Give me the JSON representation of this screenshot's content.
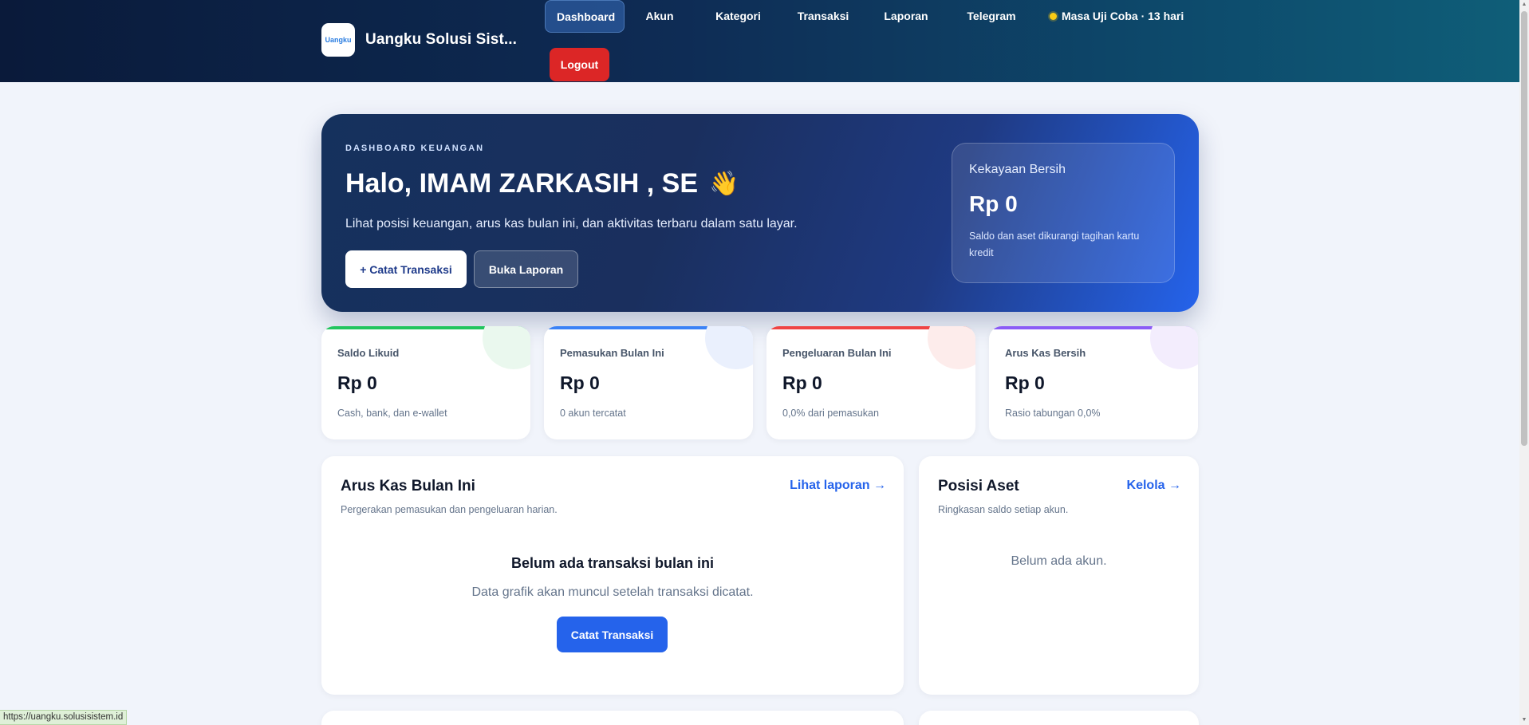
{
  "app": {
    "logo_text": "Uangku",
    "brand_name": "Uangku Solusi Sist..."
  },
  "nav": {
    "items": [
      {
        "label": "Dashboard",
        "active": true
      },
      {
        "label": "Akun"
      },
      {
        "label": "Kategori"
      },
      {
        "label": "Transaksi"
      },
      {
        "label": "Laporan"
      },
      {
        "label": "Telegram"
      }
    ],
    "trial_label": "Masa Uji Coba · 13 hari",
    "logout_label": "Logout"
  },
  "hero": {
    "kicker": "DASHBOARD KEUANGAN",
    "greeting": "Halo, IMAM ZARKASIH , SE",
    "wave": "👋",
    "subtitle": "Lihat posisi keuangan, arus kas bulan ini, dan aktivitas terbaru dalam satu layar.",
    "primary_button": "+ Catat Transaksi",
    "secondary_button": "Buka Laporan",
    "networth": {
      "title": "Kekayaan Bersih",
      "value": "Rp 0",
      "description": "Saldo dan aset dikurangi tagihan kartu kredit"
    }
  },
  "stats": [
    {
      "label": "Saldo Likuid",
      "value": "Rp 0",
      "sub": "Cash, bank, dan e-wallet",
      "color": "#22c55e",
      "tint": "#eaf8ee"
    },
    {
      "label": "Pemasukan Bulan Ini",
      "value": "Rp 0",
      "sub": "0 akun tercatat",
      "color": "#3b82f6",
      "tint": "#eaf0fd"
    },
    {
      "label": "Pengeluaran Bulan Ini",
      "value": "Rp 0",
      "sub": "0,0% dari pemasukan",
      "color": "#ef4444",
      "tint": "#fdeceb"
    },
    {
      "label": "Arus Kas Bersih",
      "value": "Rp 0",
      "sub": "Rasio tabungan 0,0%",
      "color": "#8b5cf6",
      "tint": "#f3edfd"
    }
  ],
  "cashflow": {
    "title": "Arus Kas Bulan Ini",
    "subtitle": "Pergerakan pemasukan dan pengeluaran harian.",
    "link": "Lihat laporan →",
    "empty_title": "Belum ada transaksi bulan ini",
    "empty_sub": "Data grafik akan muncul setelah transaksi dicatat.",
    "button": "Catat Transaksi"
  },
  "assets": {
    "title": "Posisi Aset",
    "subtitle": "Ringkasan saldo setiap akun.",
    "link": "Kelola →",
    "empty": "Belum ada akun."
  },
  "status_url": "https://uangku.solusisistem.id"
}
